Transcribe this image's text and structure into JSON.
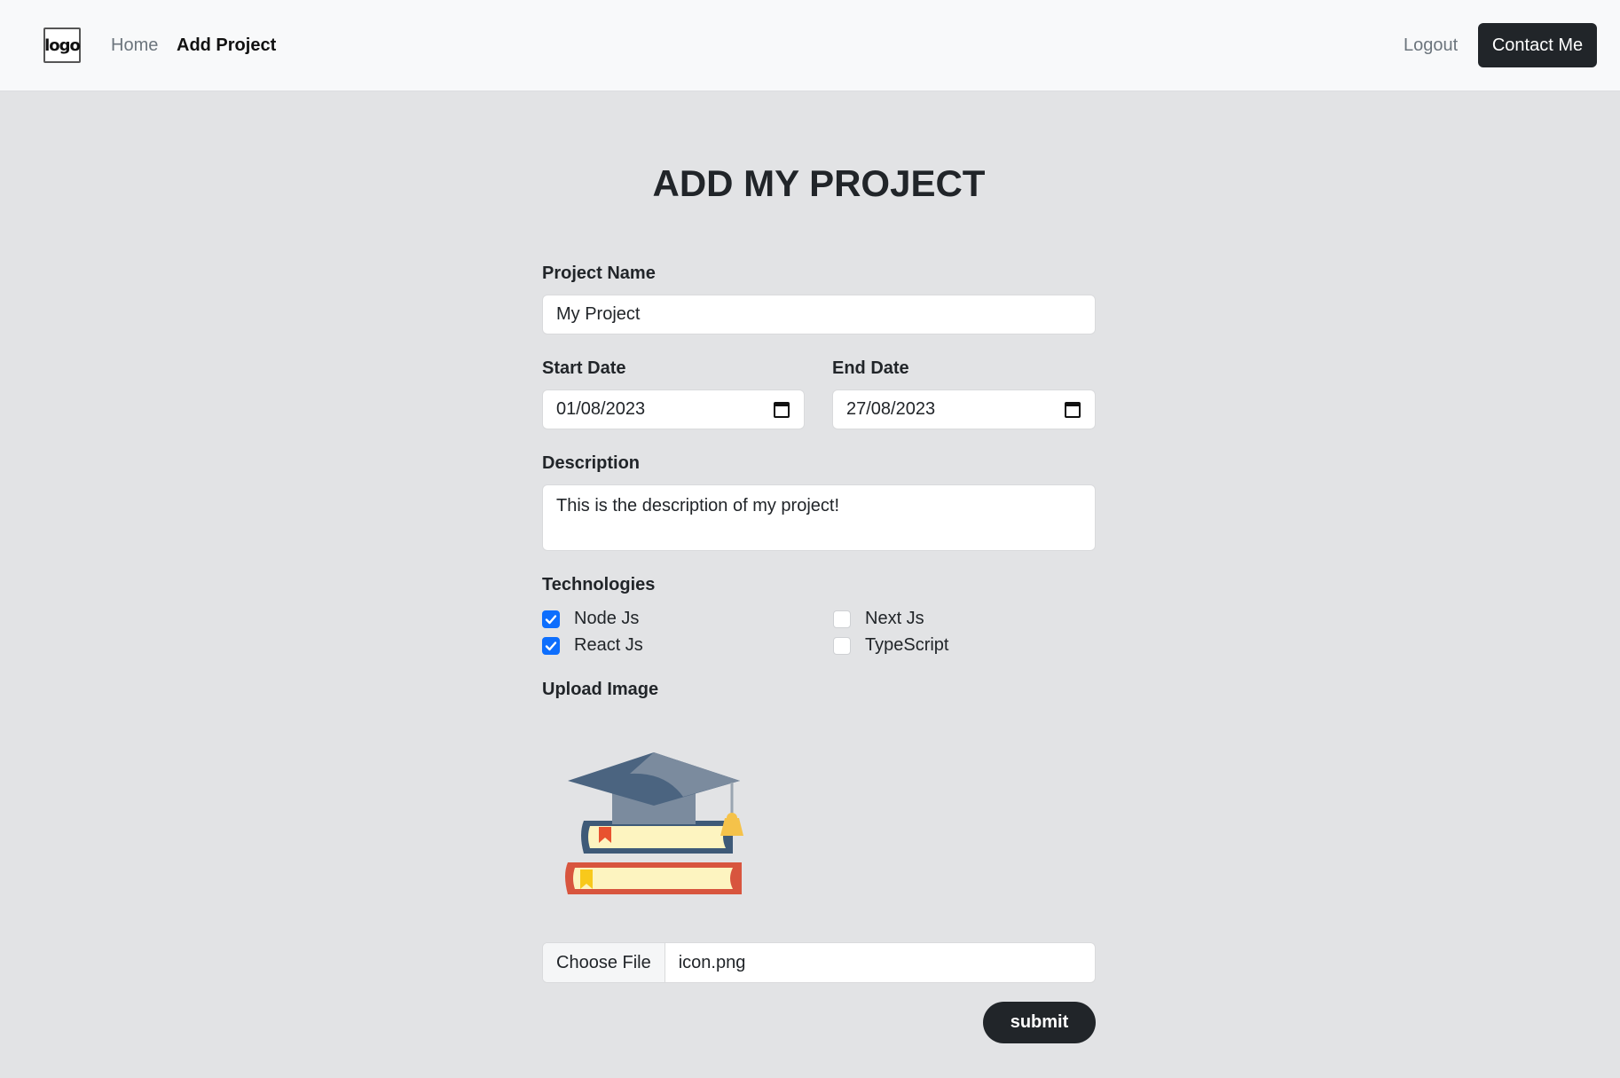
{
  "navbar": {
    "logo_text": "logo",
    "home_label": "Home",
    "add_project_label": "Add Project",
    "logout_label": "Logout",
    "contact_label": "Contact Me"
  },
  "form": {
    "title": "ADD MY PROJECT",
    "project_name": {
      "label": "Project Name",
      "value": "My Project"
    },
    "start_date": {
      "label": "Start Date",
      "value": "01/08/2023"
    },
    "end_date": {
      "label": "End Date",
      "value": "27/08/2023"
    },
    "description": {
      "label": "Description",
      "value": "This is the description of my project!"
    },
    "technologies": {
      "label": "Technologies",
      "items": [
        {
          "label": "Node Js",
          "checked": true
        },
        {
          "label": "React Js",
          "checked": true
        },
        {
          "label": "Next Js",
          "checked": false
        },
        {
          "label": "TypeScript",
          "checked": false
        }
      ]
    },
    "upload": {
      "label": "Upload Image",
      "preview_icon": "books-graduation-cap-icon",
      "choose_label": "Choose File",
      "file_name": "icon.png"
    },
    "submit_label": "submit"
  },
  "colors": {
    "page_bg": "#e2e3e5",
    "navbar_bg": "#f8f9fa",
    "dark_button": "#212529",
    "checkbox_accent": "#0d6efd"
  }
}
